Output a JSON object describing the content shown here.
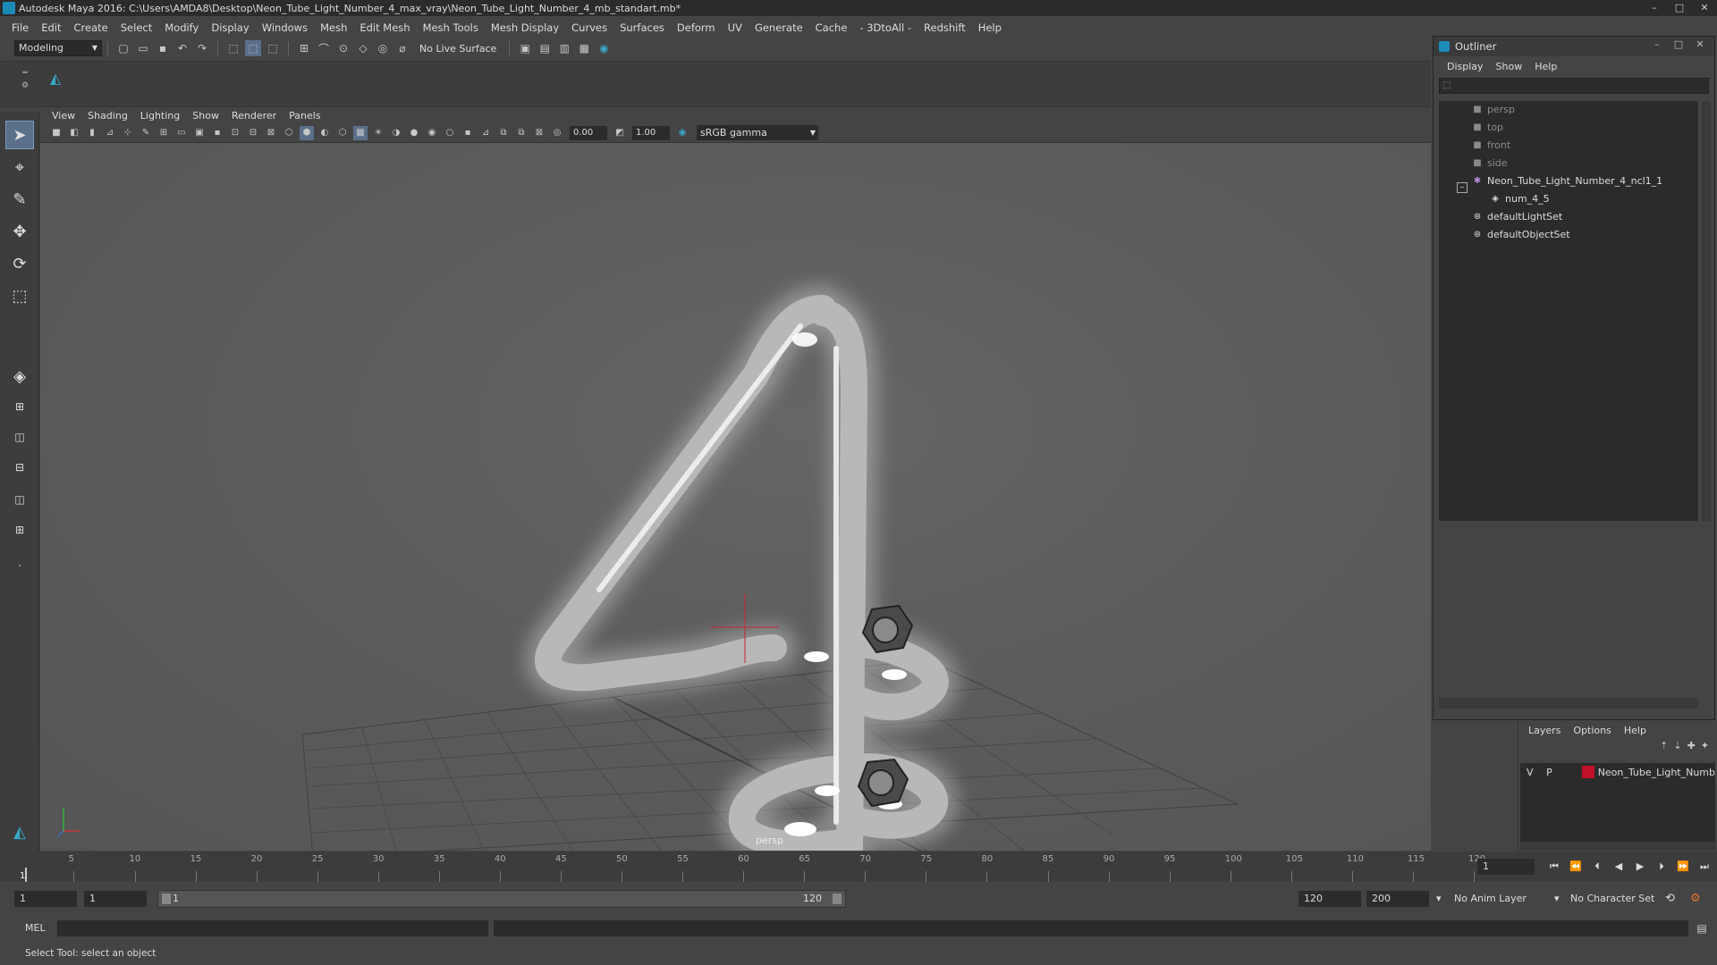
{
  "window": {
    "title": "Autodesk Maya 2016: C:\\Users\\AMDA8\\Desktop\\Neon_Tube_Light_Number_4_max_vray\\Neon_Tube_Light_Number_4_mb_standart.mb*",
    "controls": [
      "–",
      "□",
      "✕"
    ]
  },
  "menubar": [
    "File",
    "Edit",
    "Create",
    "Select",
    "Modify",
    "Display",
    "Windows",
    "Mesh",
    "Edit Mesh",
    "Mesh Tools",
    "Mesh Display",
    "Curves",
    "Surfaces",
    "Deform",
    "UV",
    "Generate",
    "Cache",
    "- 3DtoAll -",
    "Redshift",
    "Help"
  ],
  "statusline": {
    "mode": "Modeling",
    "live_surface": "No Live Surface"
  },
  "viewport": {
    "menus": [
      "View",
      "Shading",
      "Lighting",
      "Show",
      "Renderer",
      "Panels"
    ],
    "exposure": "0.00",
    "gamma": "1.00",
    "color_space": "sRGB gamma",
    "camera_label": "persp"
  },
  "outliner": {
    "title": "Outliner",
    "menus": [
      "Display",
      "Show",
      "Help"
    ],
    "items": [
      {
        "label": "persp",
        "icon": "camera-icon",
        "dim": true
      },
      {
        "label": "top",
        "icon": "camera-icon",
        "dim": true
      },
      {
        "label": "front",
        "icon": "camera-icon",
        "dim": true
      },
      {
        "label": "side",
        "icon": "camera-icon",
        "dim": true
      },
      {
        "label": "Neon_Tube_Light_Number_4_ncl1_1",
        "icon": "group-icon",
        "dim": false
      },
      {
        "label": "num_4_5",
        "icon": "mesh-icon",
        "dim": false
      },
      {
        "label": "defaultLightSet",
        "icon": "set-icon",
        "dim": false
      },
      {
        "label": "defaultObjectSet",
        "icon": "set-icon",
        "dim": false
      }
    ],
    "expand_symbol": "–"
  },
  "layers": {
    "menus": [
      "Layers",
      "Options",
      "Help"
    ],
    "row": {
      "v": "V",
      "p": "P",
      "name": "Neon_Tube_Light_Numb",
      "color": "#c0102a"
    }
  },
  "timeline": {
    "ticks": [
      "5",
      "10",
      "15",
      "20",
      "25",
      "30",
      "35",
      "40",
      "45",
      "50",
      "55",
      "60",
      "65",
      "70",
      "75",
      "80",
      "85",
      "90",
      "95",
      "100",
      "105",
      "110",
      "115",
      "120"
    ],
    "current_frame_label": "1",
    "current_frame": "1"
  },
  "range": {
    "start": "1",
    "playback_start": "1",
    "slider_start": "1",
    "slider_end": "120",
    "playback_end": "120",
    "end": "200",
    "anim_layer": "No Anim Layer",
    "character_set": "No Character Set"
  },
  "cmdline": {
    "label": "MEL"
  },
  "helpline": {
    "text": "Select Tool: select an object"
  }
}
